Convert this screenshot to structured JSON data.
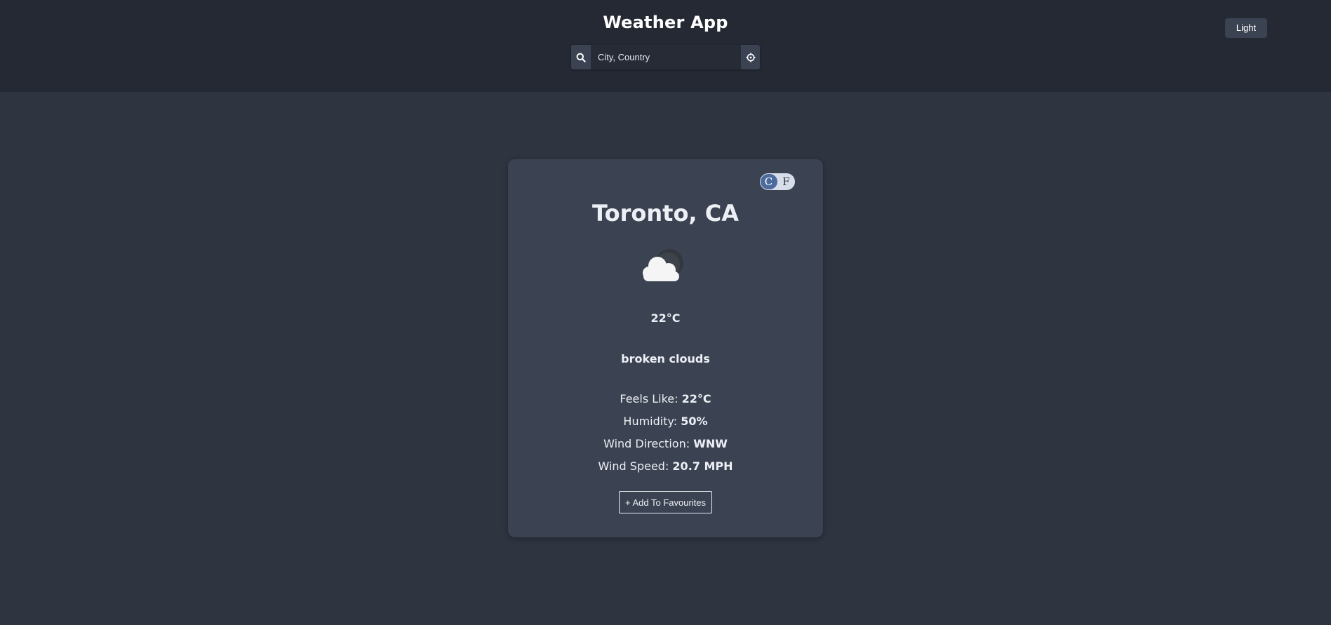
{
  "header": {
    "title": "Weather App",
    "theme_button_label": "Light",
    "search": {
      "placeholder": "City, Country",
      "value": "",
      "search_icon": "search-icon",
      "locate_icon": "crosshair-icon"
    }
  },
  "weather_card": {
    "unit_toggle": {
      "celsius": "C",
      "fahrenheit": "F",
      "selected": "C"
    },
    "location": "Toronto, CA",
    "icon": "broken-clouds-icon",
    "temperature": "22°C",
    "description": "broken clouds",
    "details": [
      {
        "label": "Feels Like:",
        "value": "22°C"
      },
      {
        "label": "Humidity:",
        "value": "50%"
      },
      {
        "label": "Wind Direction:",
        "value": "WNW"
      },
      {
        "label": "Wind Speed:",
        "value": "20.7 MPH"
      }
    ],
    "favourite_button_label": "+ Add To Favourites"
  },
  "colors": {
    "header_bg": "#242933",
    "page_bg": "#2e3440",
    "card_bg": "#3b4252",
    "toggle_active": "#4c6a9c",
    "text": "#eceff4"
  }
}
